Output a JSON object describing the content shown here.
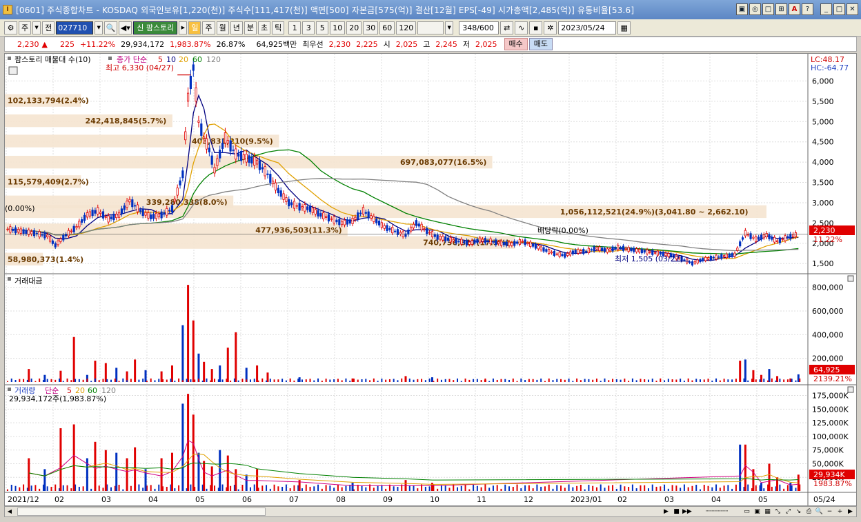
{
  "window": {
    "title": "[0601] 주식종합차트 - KOSDAQ 외국인보유[1,220(천)] 주식수[111,417(천)] 액면[500] 자본금[575(억)] 결산[12월] EPS[-49] 시가총액[2,485(억)] 유통비율[53.6]",
    "buttons": [
      "▣",
      "◎",
      "□",
      "⊞",
      "A",
      "?",
      "_",
      "□",
      "✕"
    ]
  },
  "toolbar": {
    "type_label": "주",
    "all_label": "전",
    "code_value": "027710",
    "trend_label": "신 팜스토리",
    "period_selected": "일",
    "periods": [
      "주",
      "월",
      "년",
      "분",
      "초",
      "틱"
    ],
    "intervals": [
      "1",
      "3",
      "5",
      "10",
      "20",
      "30",
      "60",
      "120"
    ],
    "count": "348/600",
    "date": "2023/05/24"
  },
  "quote": {
    "price": "2,230",
    "arrow": "▲",
    "change": "225",
    "change_rate": "+11.22%",
    "volume": "29,934,172",
    "volume_rate": "1,983.87%",
    "turnover": "26.87%",
    "amount": "64,925백만",
    "best_label": "최우선",
    "bid": "2,230",
    "ask": "2,225",
    "open_label": "시",
    "open": "2,025",
    "high_label": "고",
    "high": "2,245",
    "low_label": "저",
    "low": "2,025",
    "buy_label": "매수",
    "sell_label": "매도"
  },
  "price_panel": {
    "legend_title": "팜스토리 매물대 수(10)",
    "legend_ma": "종가 단순",
    "ma_periods": [
      "5",
      "10",
      "20",
      "60",
      "120"
    ],
    "ma_colors": [
      "#d00000",
      "#000080",
      "#e0a000",
      "#008000",
      "#808080"
    ],
    "top_right_1": "LC:48.17",
    "top_right_2": "HC:-64.77",
    "high_note": "최고 6,330 (04/27)",
    "low_note": "최저 1,505 (03/27)",
    "dividend_note": "배당락(0.00%)",
    "current_price": "2,230",
    "current_rate": "11.22%",
    "y_ticks": [
      "6,000",
      "5,500",
      "5,000",
      "4,500",
      "4,000",
      "3,500",
      "3,000",
      "2,500",
      "2,000",
      "1,500"
    ],
    "volume_profile": [
      {
        "label": "102,133,794(2.4%)",
        "price": 5520,
        "width": 0.1
      },
      {
        "label": "242,418,845(5.7%)",
        "price": 5020,
        "width": 0.22
      },
      {
        "label": "403,831,210(9.5%)",
        "price": 4520,
        "width": 0.36
      },
      {
        "label": "697,083,077(16.5%)",
        "price": 4000,
        "width": 0.64
      },
      {
        "label": "115,579,409(2.7%)",
        "price": 3520,
        "width": 0.1
      },
      {
        "label": "339,280,338(8.0%)",
        "price": 3020,
        "width": 0.3
      },
      {
        "label": "1,056,112,521(24.9%)(3,041.80 ~ 2,662.10)",
        "price": 2780,
        "width": 1.0
      },
      {
        "label": "477,936,503(11.3%)",
        "price": 2330,
        "width": 0.45
      },
      {
        "label": "740,736,817(17.5%)",
        "price": 2020,
        "width": 0.67
      },
      {
        "label": "58,980,373(1.4%)",
        "price": 1610,
        "width": 0.05
      }
    ],
    "profile_left_label": "(0.00%)"
  },
  "amount_panel": {
    "title": "거래대금",
    "y_ticks": [
      "800,000",
      "600,000",
      "400,000",
      "200,000"
    ],
    "current": "64,925",
    "current_rate": "2139.21%"
  },
  "volume_panel": {
    "title": "거래량",
    "ma_label": "단순",
    "ma_periods": [
      "5",
      "20",
      "60",
      "120"
    ],
    "sub_label": "29,934,172주(1,983.87%)",
    "y_ticks": [
      "175,000K",
      "150,000K",
      "125,000K",
      "100,000K",
      "75,000K",
      "50,000K",
      "25,000K"
    ],
    "current": "29,934K",
    "current_rate": "1983.87%"
  },
  "x_axis": {
    "labels": [
      "2021/12",
      "02",
      "03",
      "04",
      "05",
      "06",
      "07",
      "08",
      "09",
      "10",
      "11",
      "12",
      "2023/01",
      "02",
      "03",
      "04",
      "05"
    ],
    "right_label": "05/24"
  },
  "chart_data": {
    "type": "candlestick",
    "price_points": [
      [
        0,
        2350
      ],
      [
        5,
        2300
      ],
      [
        10,
        2250
      ],
      [
        15,
        2180
      ],
      [
        18,
        1950
      ],
      [
        22,
        2200
      ],
      [
        26,
        2400
      ],
      [
        30,
        2700
      ],
      [
        34,
        2800
      ],
      [
        38,
        2600
      ],
      [
        42,
        2700
      ],
      [
        46,
        3050
      ],
      [
        50,
        2800
      ],
      [
        54,
        2650
      ],
      [
        58,
        2700
      ],
      [
        62,
        2850
      ],
      [
        66,
        3700
      ],
      [
        68,
        5600
      ],
      [
        70,
        6330
      ],
      [
        72,
        5000
      ],
      [
        74,
        4600
      ],
      [
        76,
        4300
      ],
      [
        78,
        3800
      ],
      [
        82,
        4600
      ],
      [
        86,
        4200
      ],
      [
        90,
        4100
      ],
      [
        94,
        4000
      ],
      [
        98,
        3700
      ],
      [
        102,
        3300
      ],
      [
        106,
        3000
      ],
      [
        110,
        2900
      ],
      [
        114,
        2850
      ],
      [
        118,
        2700
      ],
      [
        122,
        2600
      ],
      [
        126,
        2500
      ],
      [
        130,
        2550
      ],
      [
        134,
        2800
      ],
      [
        138,
        2600
      ],
      [
        142,
        2400
      ],
      [
        146,
        2300
      ],
      [
        150,
        2200
      ],
      [
        154,
        2500
      ],
      [
        158,
        2300
      ],
      [
        162,
        2150
      ],
      [
        166,
        2100
      ],
      [
        170,
        2050
      ],
      [
        174,
        2000
      ],
      [
        178,
        2080
      ],
      [
        182,
        2050
      ],
      [
        186,
        2000
      ],
      [
        190,
        1980
      ],
      [
        194,
        2050
      ],
      [
        198,
        1950
      ],
      [
        202,
        1850
      ],
      [
        206,
        1750
      ],
      [
        210,
        1700
      ],
      [
        214,
        1800
      ],
      [
        218,
        1800
      ],
      [
        222,
        1880
      ],
      [
        226,
        1820
      ],
      [
        230,
        1900
      ],
      [
        234,
        1850
      ],
      [
        238,
        1820
      ],
      [
        242,
        1780
      ],
      [
        246,
        1750
      ],
      [
        250,
        1700
      ],
      [
        254,
        1620
      ],
      [
        258,
        1505
      ],
      [
        262,
        1600
      ],
      [
        266,
        1650
      ],
      [
        270,
        1680
      ],
      [
        274,
        1720
      ],
      [
        278,
        2250
      ],
      [
        282,
        2100
      ],
      [
        286,
        2200
      ],
      [
        290,
        2050
      ],
      [
        294,
        2150
      ],
      [
        298,
        2230
      ]
    ],
    "amount_bars": [
      [
        8,
        110000
      ],
      [
        14,
        60000
      ],
      [
        20,
        95000
      ],
      [
        25,
        380000
      ],
      [
        30,
        60000
      ],
      [
        33,
        180000
      ],
      [
        37,
        160000
      ],
      [
        41,
        120000
      ],
      [
        45,
        90000
      ],
      [
        48,
        190000
      ],
      [
        52,
        100000
      ],
      [
        58,
        90000
      ],
      [
        62,
        140000
      ],
      [
        66,
        480000
      ],
      [
        68,
        820000
      ],
      [
        70,
        520000
      ],
      [
        72,
        240000
      ],
      [
        74,
        170000
      ],
      [
        77,
        110000
      ],
      [
        80,
        140000
      ],
      [
        83,
        290000
      ],
      [
        86,
        420000
      ],
      [
        90,
        120000
      ],
      [
        94,
        140000
      ],
      [
        98,
        80000
      ],
      [
        110,
        40000
      ],
      [
        130,
        30000
      ],
      [
        150,
        50000
      ],
      [
        160,
        40000
      ],
      [
        180,
        20000
      ],
      [
        276,
        180000
      ],
      [
        278,
        190000
      ],
      [
        281,
        100000
      ],
      [
        284,
        60000
      ],
      [
        287,
        110000
      ],
      [
        290,
        50000
      ],
      [
        295,
        30000
      ],
      [
        298,
        64925
      ]
    ],
    "volume_bars": [
      [
        8,
        60000
      ],
      [
        14,
        40000
      ],
      [
        20,
        115000
      ],
      [
        25,
        122000
      ],
      [
        30,
        60000
      ],
      [
        33,
        90000
      ],
      [
        37,
        75000
      ],
      [
        41,
        70000
      ],
      [
        45,
        60000
      ],
      [
        48,
        80000
      ],
      [
        52,
        40000
      ],
      [
        58,
        60000
      ],
      [
        62,
        70000
      ],
      [
        66,
        160000
      ],
      [
        68,
        178000
      ],
      [
        70,
        140000
      ],
      [
        72,
        70000
      ],
      [
        74,
        55000
      ],
      [
        77,
        45000
      ],
      [
        80,
        75000
      ],
      [
        83,
        65000
      ],
      [
        86,
        40000
      ],
      [
        90,
        30000
      ],
      [
        94,
        40000
      ],
      [
        110,
        20000
      ],
      [
        130,
        15000
      ],
      [
        150,
        20000
      ],
      [
        160,
        15000
      ],
      [
        276,
        85000
      ],
      [
        278,
        85000
      ],
      [
        281,
        40000
      ],
      [
        284,
        15000
      ],
      [
        287,
        50000
      ],
      [
        290,
        25000
      ],
      [
        295,
        15000
      ],
      [
        298,
        29934
      ]
    ]
  }
}
